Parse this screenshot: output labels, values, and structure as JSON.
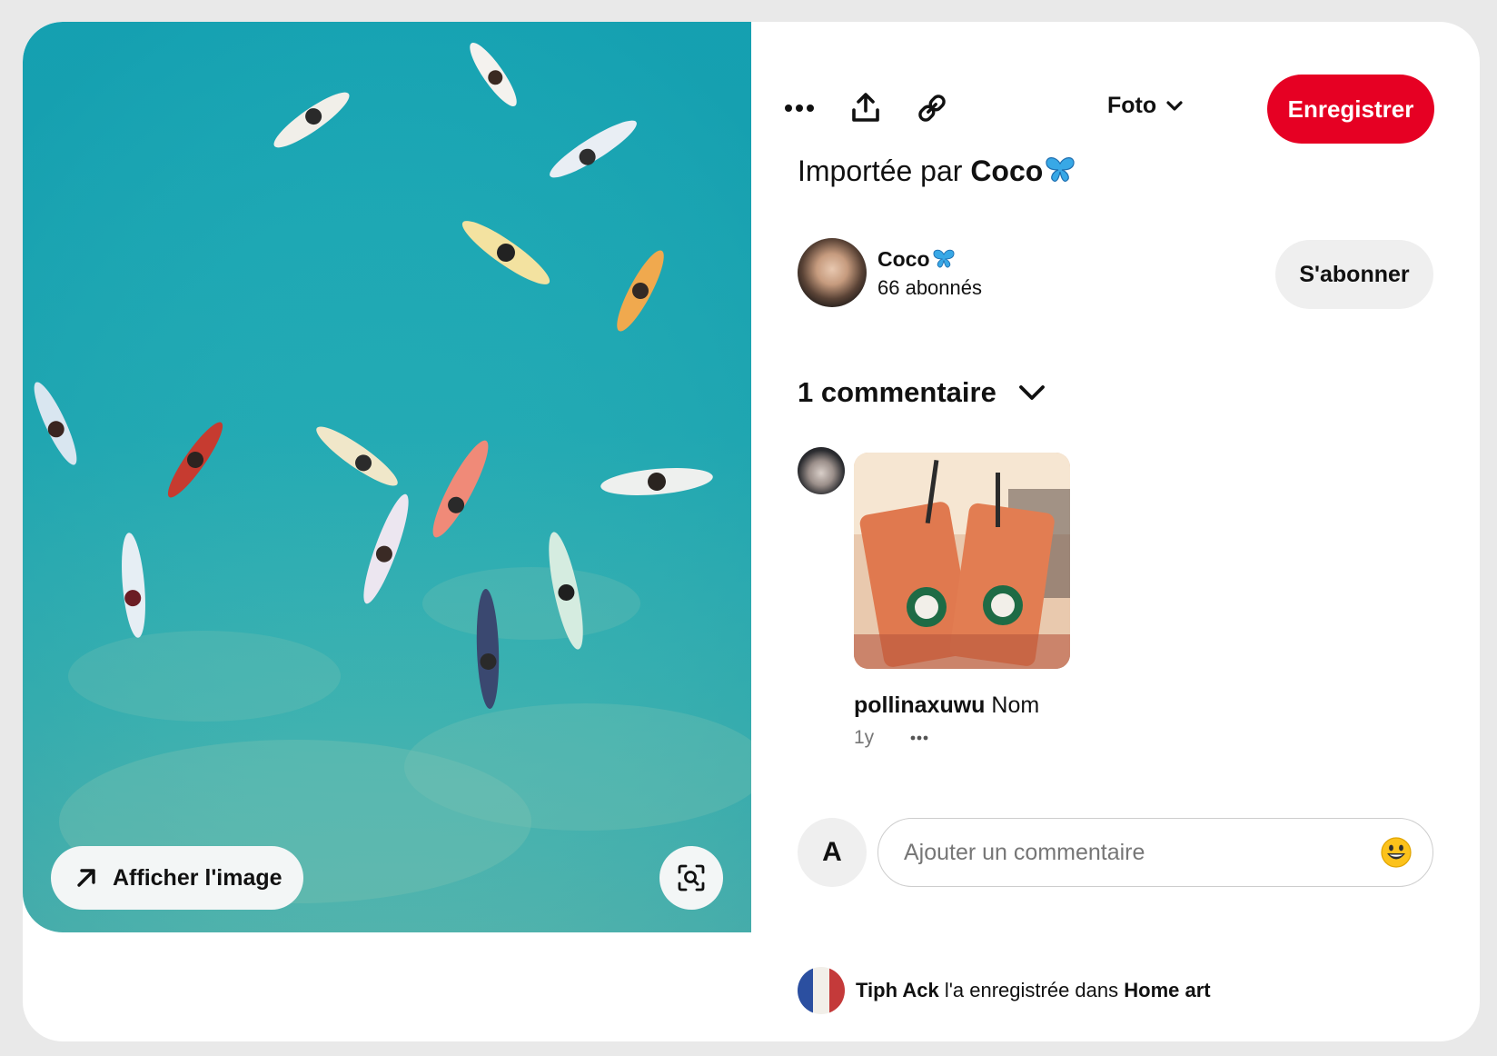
{
  "pin": {
    "show_image_label": "Afficher l'image"
  },
  "toolbar": {
    "more_icon": "more-dots-icon",
    "share_icon": "share-upload-icon",
    "link_icon": "link-icon",
    "board_select": "Foto",
    "save_label": "Enregistrer",
    "save_color": "#e60023"
  },
  "imported": {
    "prefix": "Importée par",
    "user": "Coco"
  },
  "creator": {
    "name": "Coco",
    "followers": "66 abonnés",
    "subscribe_label": "S'abonner"
  },
  "comments": {
    "header": "1 commentaire",
    "items": [
      {
        "user": "pollinaxuwu",
        "text": "Nom",
        "time": "1y"
      }
    ]
  },
  "add_comment": {
    "avatar_letter": "A",
    "placeholder": "Ajouter un commentaire"
  },
  "saved_by": {
    "user": "Tiph Ack",
    "middle": "l'a enregistrée dans",
    "board": "Home art"
  }
}
